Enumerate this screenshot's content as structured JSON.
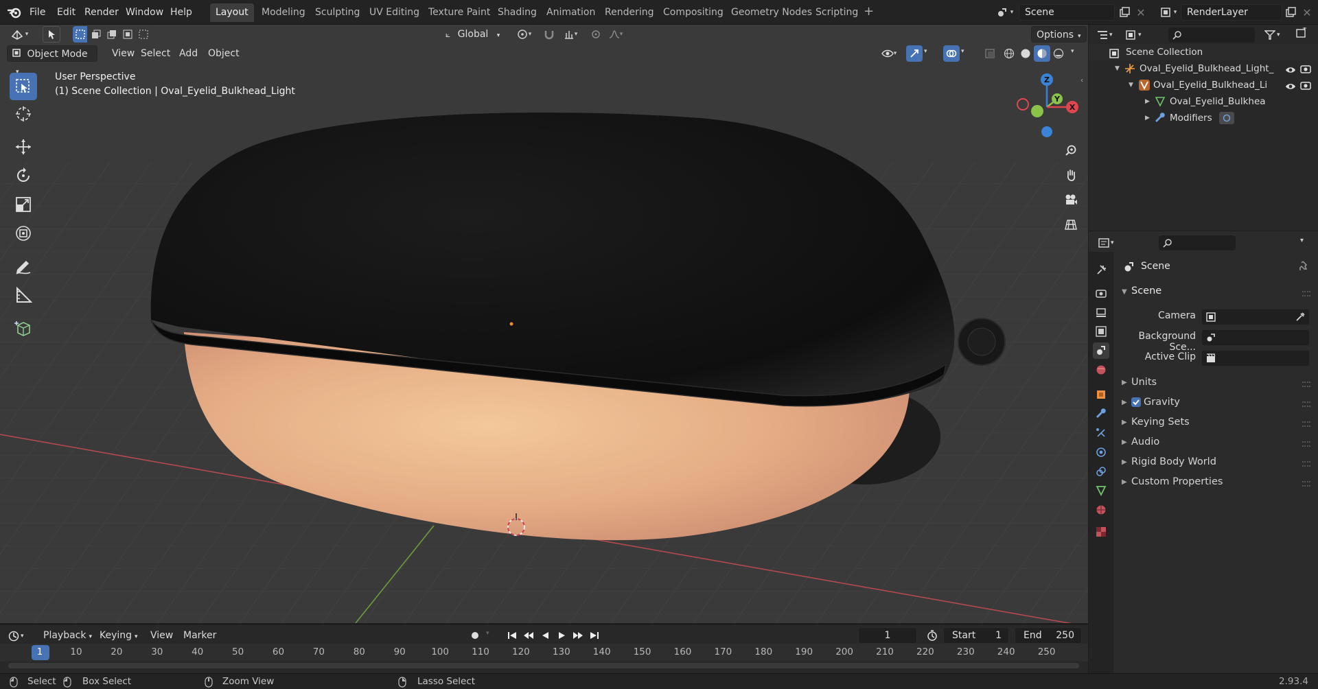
{
  "topbar": {
    "menus": [
      "File",
      "Edit",
      "Render",
      "Window",
      "Help"
    ],
    "workspaces": [
      "Layout",
      "Modeling",
      "Sculpting",
      "UV Editing",
      "Texture Paint",
      "Shading",
      "Animation",
      "Rendering",
      "Compositing",
      "Geometry Nodes",
      "Scripting"
    ],
    "active_workspace": "Layout",
    "scene_name": "Scene",
    "view_layer": "RenderLayer"
  },
  "viewport": {
    "transform_orientation": "Global",
    "options_label": "Options",
    "mode": "Object Mode",
    "menus": [
      "View",
      "Select",
      "Add",
      "Object"
    ],
    "overlay_text_1": "User Perspective",
    "overlay_text_2": "(1) Scene Collection | Oval_Eyelid_Bulkhead_Light",
    "gizmo_axes": [
      "Z",
      "Y",
      "X"
    ]
  },
  "outliner": {
    "root": "Scene Collection",
    "items": [
      {
        "label": "Oval_Eyelid_Bulkhead_Light_",
        "icon": "empty-icon"
      },
      {
        "label": "Oval_Eyelid_Bulkhead_Li",
        "icon": "object-icon"
      },
      {
        "label": "Oval_Eyelid_Bulkhea",
        "icon": "mesh-icon"
      },
      {
        "label": "Modifiers",
        "icon": "wrench-icon"
      }
    ]
  },
  "properties": {
    "context_title": "Scene",
    "panel_title": "Scene",
    "fields": {
      "camera_label": "Camera",
      "background_label": "Background Sce...",
      "active_clip_label": "Active Clip"
    },
    "panels": [
      {
        "label": "Units",
        "checkbox": false
      },
      {
        "label": "Gravity",
        "checkbox": true
      },
      {
        "label": "Keying Sets",
        "checkbox": false
      },
      {
        "label": "Audio",
        "checkbox": false
      },
      {
        "label": "Rigid Body World",
        "checkbox": false
      },
      {
        "label": "Custom Properties",
        "checkbox": false
      }
    ]
  },
  "timeline": {
    "menus": [
      "Playback",
      "Keying",
      "View",
      "Marker"
    ],
    "current_frame": "1",
    "start_label": "Start",
    "start_value": "1",
    "end_label": "End",
    "end_value": "250",
    "ticks": [
      "1",
      "10",
      "20",
      "30",
      "40",
      "50",
      "60",
      "70",
      "80",
      "90",
      "100",
      "110",
      "120",
      "130",
      "140",
      "150",
      "160",
      "170",
      "180",
      "190",
      "200",
      "210",
      "220",
      "230",
      "240",
      "250"
    ]
  },
  "statusbar": {
    "select": "Select",
    "box_select": "Box Select",
    "zoom_view": "Zoom View",
    "lasso_select": "Lasso Select",
    "version": "2.93.4"
  },
  "colors": {
    "accent": "#4772b3",
    "axis_x": "#e04550",
    "axis_y": "#8bc34a",
    "axis_z": "#3b82d6"
  }
}
